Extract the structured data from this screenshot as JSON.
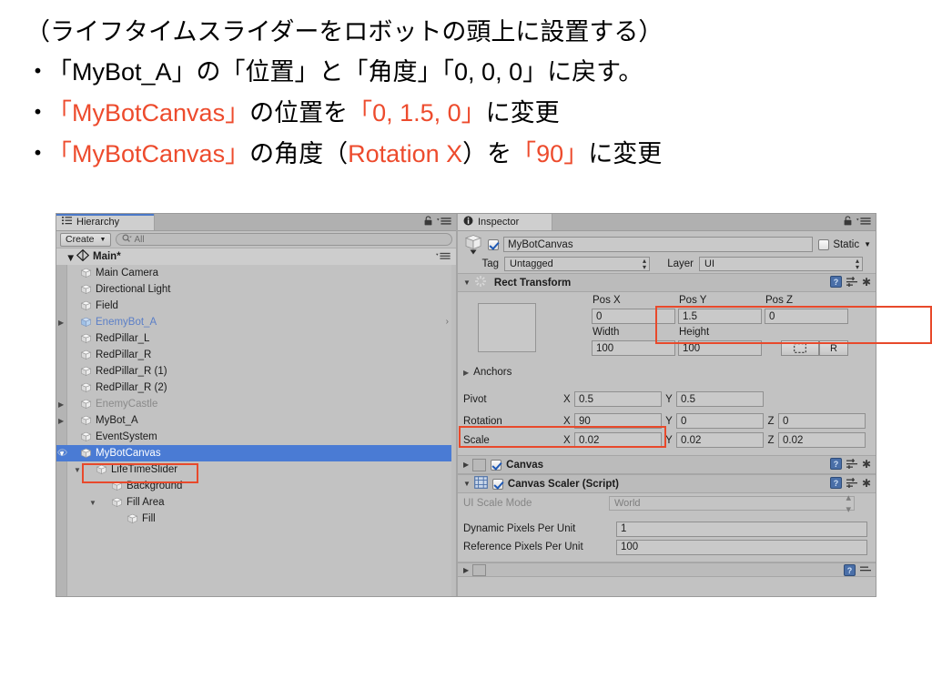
{
  "slide": {
    "title": "（ライフタイムスライダーをロボットの頭上に設置する）",
    "bullets": [
      {
        "marker": "・",
        "segments": [
          {
            "text": "「MyBot_A」の「位置」と「角度」「0, 0, 0」に戻す。",
            "color": "black"
          }
        ]
      },
      {
        "marker": "・",
        "segments": [
          {
            "text": "「MyBotCanvas」",
            "color": "red"
          },
          {
            "text": "の位置を",
            "color": "black"
          },
          {
            "text": "「0, 1.5, 0」",
            "color": "red"
          },
          {
            "text": "に変更",
            "color": "black"
          }
        ]
      },
      {
        "marker": "・",
        "segments": [
          {
            "text": "「MyBotCanvas」",
            "color": "red"
          },
          {
            "text": "の角度（",
            "color": "black"
          },
          {
            "text": "Rotation X",
            "color": "red"
          },
          {
            "text": "）を",
            "color": "black"
          },
          {
            "text": "「90」",
            "color": "red"
          },
          {
            "text": "に変更",
            "color": "black"
          }
        ]
      }
    ],
    "accent_color": "#ED4B2D",
    "text_color": "#000000"
  },
  "hierarchy": {
    "tab_label": "Hierarchy",
    "tab_icon": "list-icon",
    "lock_icon": "lock-icon",
    "menu_icon": "hamburger-menu-icon",
    "create_label": "Create",
    "search_placeholder": "All",
    "search_value": "",
    "search_icon": "search-icon",
    "scene_name": "Main*",
    "scene_icon": "unity-logo-icon",
    "items": [
      {
        "label": "Main Camera",
        "depth": 1,
        "arrow": "",
        "style": "normal",
        "selected": false,
        "chevron": false
      },
      {
        "label": "Directional Light",
        "depth": 1,
        "arrow": "",
        "style": "normal",
        "selected": false,
        "chevron": false
      },
      {
        "label": "Field",
        "depth": 1,
        "arrow": "",
        "style": "normal",
        "selected": false,
        "chevron": false
      },
      {
        "label": "EnemyBot_A",
        "depth": 1,
        "arrow": "right",
        "style": "prefab",
        "selected": false,
        "chevron": true
      },
      {
        "label": "RedPillar_L",
        "depth": 1,
        "arrow": "",
        "style": "normal",
        "selected": false,
        "chevron": false
      },
      {
        "label": "RedPillar_R",
        "depth": 1,
        "arrow": "",
        "style": "normal",
        "selected": false,
        "chevron": false
      },
      {
        "label": "RedPillar_R (1)",
        "depth": 1,
        "arrow": "",
        "style": "normal",
        "selected": false,
        "chevron": false
      },
      {
        "label": "RedPillar_R (2)",
        "depth": 1,
        "arrow": "",
        "style": "normal",
        "selected": false,
        "chevron": false
      },
      {
        "label": "EnemyCastle",
        "depth": 1,
        "arrow": "right",
        "style": "inactive",
        "selected": false,
        "chevron": false
      },
      {
        "label": "MyBot_A",
        "depth": 1,
        "arrow": "right",
        "style": "normal",
        "selected": false,
        "chevron": false
      },
      {
        "label": "EventSystem",
        "depth": 1,
        "arrow": "",
        "style": "normal",
        "selected": false,
        "chevron": false
      },
      {
        "label": "MyBotCanvas",
        "depth": 1,
        "arrow": "down",
        "style": "normal",
        "selected": true,
        "chevron": false
      },
      {
        "label": "LifeTimeSlider",
        "depth": 2,
        "arrow": "down",
        "style": "normal",
        "selected": false,
        "chevron": false
      },
      {
        "label": "Background",
        "depth": 3,
        "arrow": "",
        "style": "normal",
        "selected": false,
        "chevron": false
      },
      {
        "label": "Fill Area",
        "depth": 3,
        "arrow": "down",
        "style": "normal",
        "selected": false,
        "chevron": false
      },
      {
        "label": "Fill",
        "depth": 4,
        "arrow": "",
        "style": "normal",
        "selected": false,
        "chevron": false
      }
    ]
  },
  "inspector": {
    "tab_label": "Inspector",
    "tab_icon": "info-icon",
    "lock_icon": "lock-icon",
    "menu_icon": "hamburger-menu-icon",
    "object_enabled": true,
    "object_name": "MyBotCanvas",
    "static_label": "Static",
    "static_checked": false,
    "tag_label": "Tag",
    "tag_value": "Untagged",
    "layer_label": "Layer",
    "layer_value": "UI",
    "rect_transform": {
      "title": "Rect Transform",
      "pos_labels": [
        "Pos X",
        "Pos Y",
        "Pos Z"
      ],
      "pos_values": [
        "0",
        "1.5",
        "0"
      ],
      "size_labels": [
        "Width",
        "Height"
      ],
      "size_values": [
        "100",
        "100"
      ],
      "blueprint_label": "R",
      "anchors_label": "Anchors",
      "pivot_label": "Pivot",
      "pivot_axes": [
        "X",
        "Y"
      ],
      "pivot_values": [
        "0.5",
        "0.5"
      ],
      "rotation_label": "Rotation",
      "rotation_axes": [
        "X",
        "Y",
        "Z"
      ],
      "rotation_values": [
        "90",
        "0",
        "0"
      ],
      "scale_label": "Scale",
      "scale_axes": [
        "X",
        "Y",
        "Z"
      ],
      "scale_values": [
        "0.02",
        "0.02",
        "0.02"
      ]
    },
    "canvas": {
      "title": "Canvas",
      "enabled": true
    },
    "canvas_scaler": {
      "title": "Canvas Scaler (Script)",
      "enabled": true,
      "ui_scale_mode_label": "UI Scale Mode",
      "ui_scale_mode_value": "World",
      "dynamic_label": "Dynamic Pixels Per Unit",
      "dynamic_value": "1",
      "reference_label": "Reference Pixels Per Unit",
      "reference_value": "100"
    },
    "help_icon": "help-book-icon",
    "preset_icon": "preset-sliders-icon",
    "gear_icon": "gear-icon"
  },
  "annotations": {
    "box_color": "#E8492B",
    "boxes": [
      "hierarchy-mybotcanvas",
      "inspector-position-row",
      "inspector-rotation-row"
    ]
  }
}
